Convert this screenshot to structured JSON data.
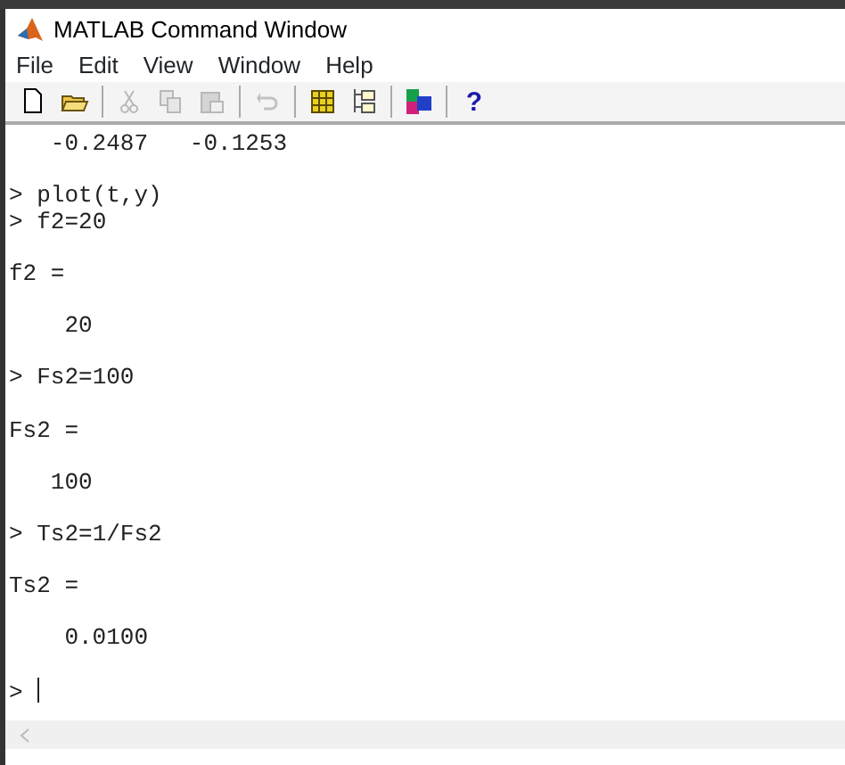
{
  "window": {
    "title": "MATLAB Command Window"
  },
  "menu": [
    "File",
    "Edit",
    "View",
    "Window",
    "Help"
  ],
  "toolbar": [
    {
      "kind": "new",
      "disabled": false
    },
    {
      "kind": "open",
      "disabled": false
    },
    {
      "kind": "sep"
    },
    {
      "kind": "cut",
      "disabled": true
    },
    {
      "kind": "copy",
      "disabled": true
    },
    {
      "kind": "paste",
      "disabled": true
    },
    {
      "kind": "sep"
    },
    {
      "kind": "undo",
      "disabled": true
    },
    {
      "kind": "sep"
    },
    {
      "kind": "workspace",
      "disabled": false
    },
    {
      "kind": "path",
      "disabled": false
    },
    {
      "kind": "sep"
    },
    {
      "kind": "model",
      "disabled": false
    },
    {
      "kind": "sep"
    },
    {
      "kind": "help",
      "label": "?",
      "disabled": false
    }
  ],
  "console": [
    {
      "kind": "output",
      "text": "   -0.2487   -0.1253"
    },
    {
      "kind": "blank"
    },
    {
      "kind": "command",
      "prompt": ">",
      "text": "plot(t,y)"
    },
    {
      "kind": "command",
      "prompt": ">",
      "text": "f2=20"
    },
    {
      "kind": "blank"
    },
    {
      "kind": "output",
      "text": "f2 ="
    },
    {
      "kind": "blank"
    },
    {
      "kind": "output",
      "text": "    20"
    },
    {
      "kind": "blank"
    },
    {
      "kind": "command",
      "prompt": ">",
      "text": "Fs2=100"
    },
    {
      "kind": "blank"
    },
    {
      "kind": "output",
      "text": "Fs2 ="
    },
    {
      "kind": "blank"
    },
    {
      "kind": "output",
      "text": "   100"
    },
    {
      "kind": "blank"
    },
    {
      "kind": "command",
      "prompt": ">",
      "text": "Ts2=1/Fs2"
    },
    {
      "kind": "blank"
    },
    {
      "kind": "output",
      "text": "Ts2 ="
    },
    {
      "kind": "blank"
    },
    {
      "kind": "output",
      "text": "    0.0100"
    },
    {
      "kind": "blank"
    },
    {
      "kind": "input",
      "prompt": ">"
    }
  ]
}
